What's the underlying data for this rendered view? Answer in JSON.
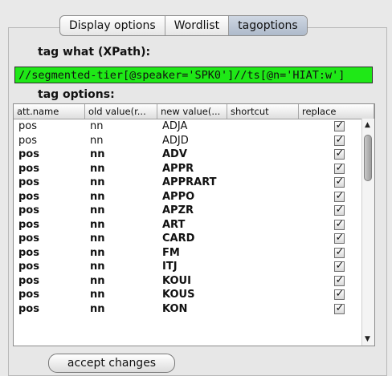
{
  "tabs": [
    "Display options",
    "Wordlist",
    "tagoptions"
  ],
  "tag_what_label": "tag what (XPath):",
  "xpath_value": "//segmented-tier[@speaker='SPK0']//ts[@n='HIAT:w']",
  "tag_options_label": "tag options:",
  "columns": [
    "att.name",
    "old value(r...",
    "new value(...",
    "shortcut",
    "replace"
  ],
  "rows": [
    {
      "att": "pos",
      "old": "nn",
      "new": "ADJA",
      "checked": true
    },
    {
      "att": "pos",
      "old": "nn",
      "new": "ADJD",
      "checked": true
    },
    {
      "att": "pos",
      "old": "nn",
      "new": "ADV",
      "checked": true
    },
    {
      "att": "pos",
      "old": "nn",
      "new": "APPR",
      "checked": true
    },
    {
      "att": "pos",
      "old": "nn",
      "new": "APPRART",
      "checked": true
    },
    {
      "att": "pos",
      "old": "nn",
      "new": "APPO",
      "checked": true
    },
    {
      "att": "pos",
      "old": "nn",
      "new": "APZR",
      "checked": true
    },
    {
      "att": "pos",
      "old": "nn",
      "new": "ART",
      "checked": true
    },
    {
      "att": "pos",
      "old": "nn",
      "new": "CARD",
      "checked": true
    },
    {
      "att": "pos",
      "old": "nn",
      "new": "FM",
      "checked": true
    },
    {
      "att": "pos",
      "old": "nn",
      "new": "ITJ",
      "checked": true
    },
    {
      "att": "pos",
      "old": "nn",
      "new": "KOUI",
      "checked": true
    },
    {
      "att": "pos",
      "old": "nn",
      "new": "KOUS",
      "checked": true
    },
    {
      "att": "pos",
      "old": "nn",
      "new": "KON",
      "checked": true
    }
  ],
  "button_label": "accept changes",
  "colors": {
    "xpath_bg": "#1fe817",
    "selected_tab": "#b3c0d1"
  }
}
